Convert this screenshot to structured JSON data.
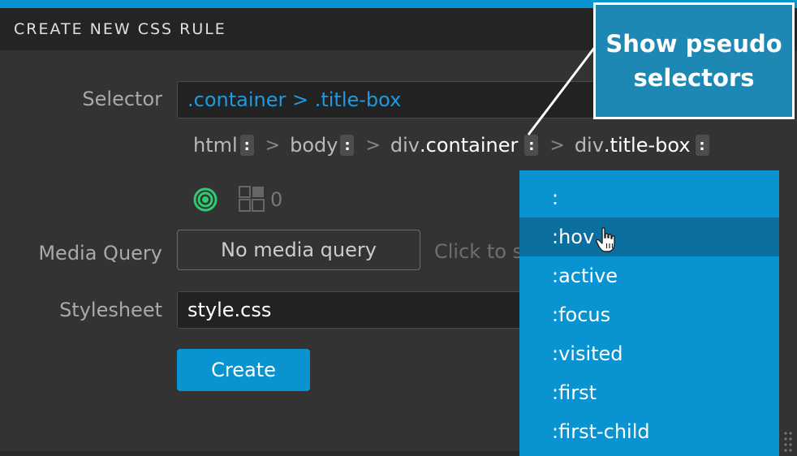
{
  "header": {
    "title": "CREATE NEW CSS RULE"
  },
  "selector": {
    "label": "Selector",
    "value": ".container > .title-box",
    "breadcrumbs": [
      {
        "tag": "html",
        "cls": ""
      },
      {
        "tag": "body",
        "cls": ""
      },
      {
        "tag": "div",
        "cls": ".container"
      },
      {
        "tag": "div",
        "cls": ".title-box"
      }
    ],
    "pseudo_glyph": ":",
    "separator": ">",
    "match_count": "0"
  },
  "media_query": {
    "label": "Media Query",
    "button": "No media query",
    "hint": "Click to s"
  },
  "stylesheet": {
    "label": "Stylesheet",
    "value": "style.css"
  },
  "create_button": "Create",
  "pseudo_dropdown": {
    "items": [
      ":",
      ":hov",
      ":active",
      ":focus",
      ":visited",
      ":first",
      ":first-child"
    ],
    "hovered_index": 1
  },
  "callout": {
    "line1": "Show pseudo",
    "line2": "selectors"
  },
  "colors": {
    "accent": "#0a93d1",
    "hover": "#0a6f9e",
    "callout": "#1c88b3",
    "target": "#2ecc71"
  }
}
